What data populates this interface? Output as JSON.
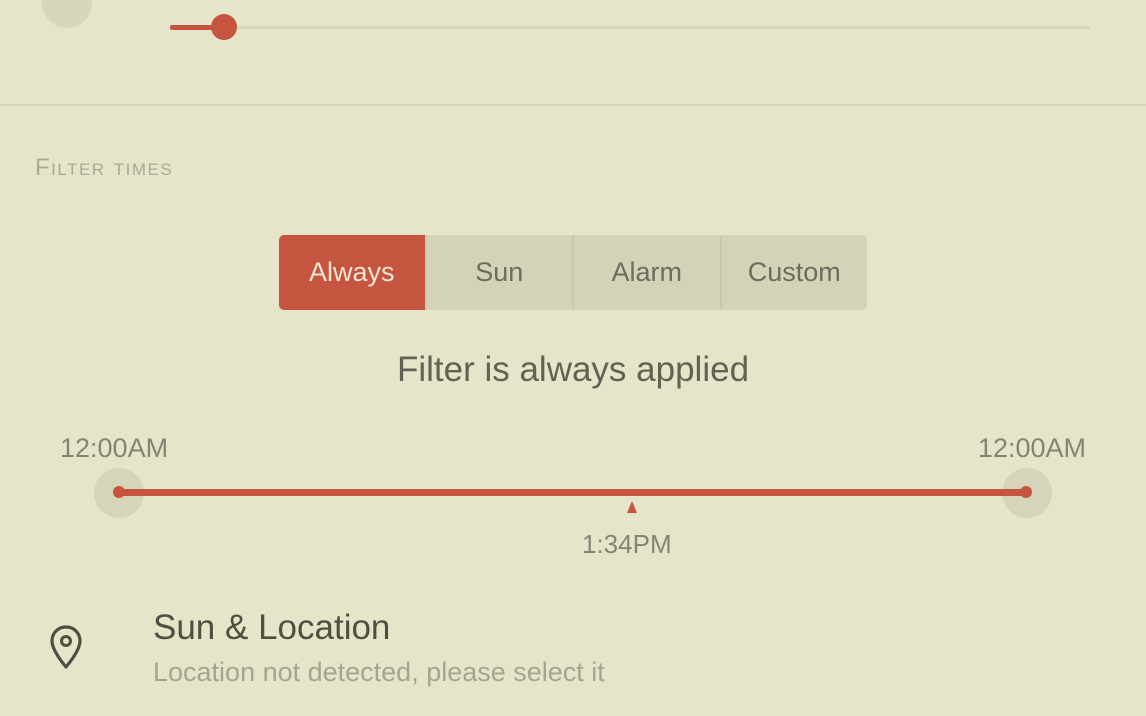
{
  "intensity": {
    "level_percent": 5
  },
  "filter_times": {
    "section_title": "Filter times",
    "modes": [
      {
        "label": "Always",
        "selected": true
      },
      {
        "label": "Sun",
        "selected": false
      },
      {
        "label": "Alarm",
        "selected": false
      },
      {
        "label": "Custom",
        "selected": false
      }
    ],
    "status": "Filter is always applied",
    "range": {
      "start": "12:00AM",
      "end": "12:00AM",
      "current_time": "1:34PM"
    }
  },
  "location": {
    "icon": "location-pin-icon",
    "title": "Sun & Location",
    "subtitle": "Location not detected, please select it"
  },
  "colors": {
    "accent": "#c5553e",
    "background": "#e7e5c9"
  }
}
